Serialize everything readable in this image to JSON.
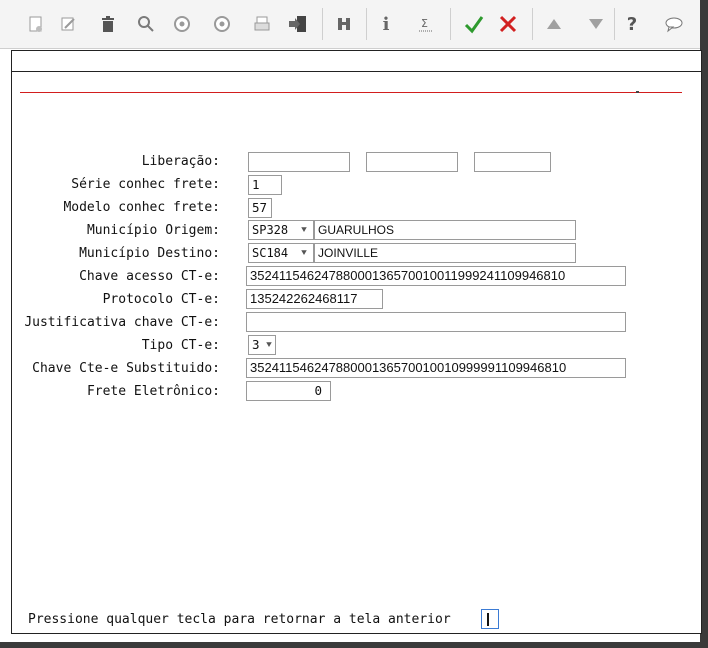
{
  "toolbar": {
    "buttons": [
      {
        "name": "new-icon",
        "glyph": "▢"
      },
      {
        "name": "edit-icon",
        "glyph": "✎"
      },
      {
        "name": "delete-icon",
        "glyph": "🗑"
      },
      {
        "name": "search-icon",
        "glyph": "⌕"
      },
      {
        "name": "previous-icon",
        "glyph": "◂"
      },
      {
        "name": "next-icon",
        "glyph": "▸"
      },
      {
        "name": "print-icon",
        "glyph": "⎙"
      },
      {
        "name": "exit-icon",
        "glyph": "➜"
      },
      {
        "name": "binoculars-icon",
        "glyph": "⚲"
      },
      {
        "name": "info-icon",
        "glyph": "i"
      },
      {
        "name": "sum-icon",
        "glyph": "Σ"
      },
      {
        "name": "confirm-icon",
        "glyph": "✔"
      },
      {
        "name": "cancel-icon",
        "glyph": "✖"
      },
      {
        "name": "up-icon",
        "glyph": "▲"
      },
      {
        "name": "down-icon",
        "glyph": "▼"
      },
      {
        "name": "help-icon",
        "glyph": "?"
      },
      {
        "name": "comment-icon",
        "glyph": "○"
      }
    ],
    "colors": {
      "confirm": "#2e9a2e",
      "cancel": "#d22020",
      "muted": "#9a9a9a"
    }
  },
  "form": {
    "liberacao": {
      "label": "Liberação:",
      "values": [
        "",
        "",
        ""
      ]
    },
    "serie": {
      "label": "Série conhec frete:",
      "value": "1"
    },
    "modelo": {
      "label": "Modelo conhec frete:",
      "value": "57"
    },
    "origem": {
      "label": "Município Origem:",
      "code": "SP328",
      "city": "GUARULHOS"
    },
    "destino": {
      "label": "Município Destino:",
      "code": "SC184",
      "city": "JOINVILLE"
    },
    "chave": {
      "label": "Chave acesso CT-e:",
      "value": "35241154624788000136570010011999241109946810"
    },
    "protocolo": {
      "label": "Protocolo CT-e:",
      "value": "135242262468117"
    },
    "justificativa": {
      "label": "Justificativa chave CT-e:",
      "value": ""
    },
    "tipo": {
      "label": "Tipo CT-e:",
      "value": "3"
    },
    "substituido": {
      "label": "Chave Cte-e Substituido:",
      "value": "35241154624788000136570010010999991109946810"
    },
    "frete": {
      "label": "Frete Eletrônico:",
      "value": "0"
    }
  },
  "footer": {
    "message": "Pressione qualquer tecla para retornar a tela anterior"
  }
}
